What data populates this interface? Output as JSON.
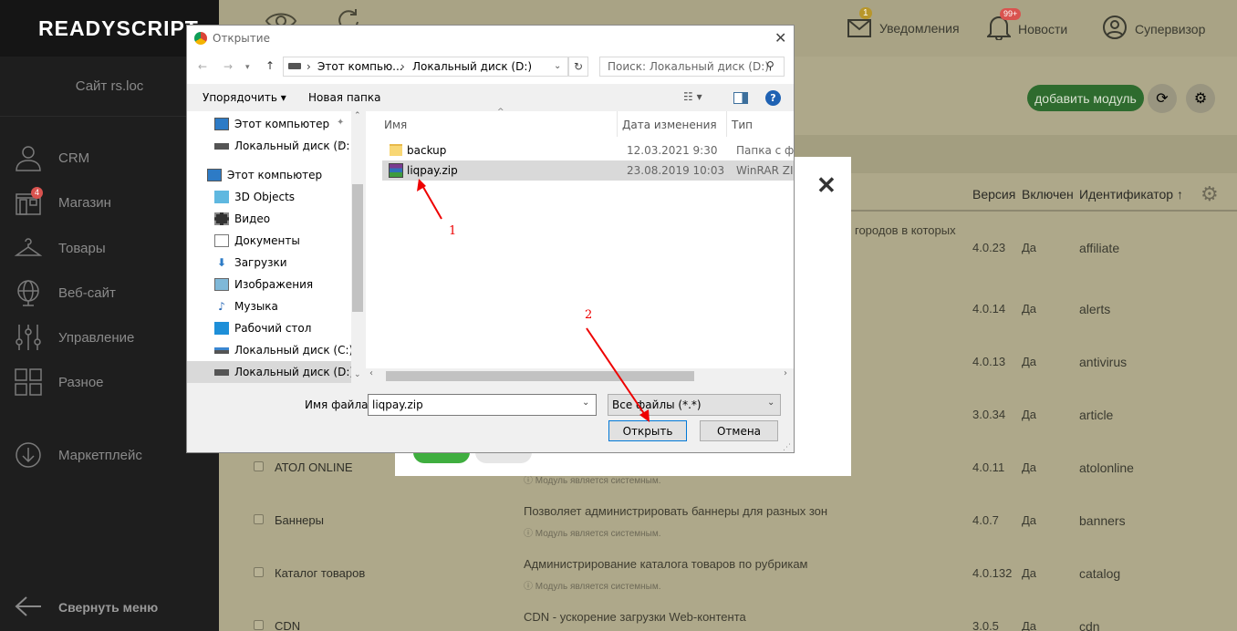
{
  "brand": "READYSCRIPT",
  "site_label": "Сайт rs.loc",
  "nav": [
    {
      "label": "CRM",
      "icon": "users-icon"
    },
    {
      "label": "Магазин",
      "icon": "store-icon",
      "badge": "4"
    },
    {
      "label": "Товары",
      "icon": "hanger-icon"
    },
    {
      "label": "Веб-сайт",
      "icon": "globe-icon"
    },
    {
      "label": "Управление",
      "icon": "sliders-icon"
    },
    {
      "label": "Разное",
      "icon": "grid-icon"
    },
    {
      "label": "Маркетплейс",
      "icon": "download-circle-icon"
    }
  ],
  "collapse_label": "Свернуть меню",
  "topbar": {
    "notifications": {
      "label": "Уведомления",
      "badge": "1"
    },
    "news": {
      "label": "Новости",
      "badge": "99+"
    },
    "user": {
      "label": "Супервизор"
    }
  },
  "add_module": "добавить модуль",
  "columns": {
    "version": "Версия",
    "enabled": "Включен",
    "identifier": "Идентификатор ↑"
  },
  "modules": [
    {
      "name": "",
      "desc": "городов в которых",
      "version": "4.0.23",
      "enabled": "Да",
      "id": "affiliate"
    },
    {
      "name": "",
      "desc": "",
      "version": "4.0.14",
      "enabled": "Да",
      "id": "alerts"
    },
    {
      "name": "",
      "desc": "",
      "version": "4.0.13",
      "enabled": "Да",
      "id": "antivirus"
    },
    {
      "name": "",
      "desc": "",
      "version": "3.0.34",
      "enabled": "Да",
      "id": "article"
    },
    {
      "name": "АТОЛ ONLINE",
      "desc": "",
      "note": "ⓘ Модуль является системным.",
      "version": "4.0.11",
      "enabled": "Да",
      "id": "atolonline"
    },
    {
      "name": "Баннеры",
      "desc": "Позволяет администрировать баннеры для разных зон",
      "note": "ⓘ Модуль является системным.",
      "version": "4.0.7",
      "enabled": "Да",
      "id": "banners"
    },
    {
      "name": "Каталог товаров",
      "desc": "Администрирование каталога товаров по рубрикам",
      "note": "ⓘ Модуль является системным.",
      "version": "4.0.132",
      "enabled": "Да",
      "id": "catalog"
    },
    {
      "name": "CDN",
      "desc": "CDN - ускорение загрузки Web-контента",
      "version": "3.0.5",
      "enabled": "Да",
      "id": "cdn"
    }
  ],
  "dialog": {
    "title": "Открытие",
    "path": [
      "Этот компью...",
      "Локальный диск (D:)"
    ],
    "search_placeholder": "Поиск: Локальный диск (D:)",
    "organize": "Упорядочить ▾",
    "new_folder": "Новая папка",
    "tree": [
      {
        "label": "Этот компьютер",
        "icon": "computer-icon",
        "pinned": true
      },
      {
        "label": "Локальный диск (D:",
        "icon": "drive-icon",
        "pinned": true
      },
      {
        "label": "Этот компьютер",
        "icon": "computer-icon"
      },
      {
        "label": "3D Objects",
        "icon": "cube-icon"
      },
      {
        "label": "Видео",
        "icon": "film-icon"
      },
      {
        "label": "Документы",
        "icon": "document-icon"
      },
      {
        "label": "Загрузки",
        "icon": "download-arrow-icon"
      },
      {
        "label": "Изображения",
        "icon": "picture-icon"
      },
      {
        "label": "Музыка",
        "icon": "music-note-icon"
      },
      {
        "label": "Рабочий стол",
        "icon": "desktop-icon"
      },
      {
        "label": "Локальный диск (C:)",
        "icon": "drive-c-icon"
      },
      {
        "label": "Локальный диск (D:)",
        "icon": "drive-icon"
      }
    ],
    "columns": {
      "name": "Имя",
      "date": "Дата изменения",
      "type": "Тип"
    },
    "files": [
      {
        "name": "backup",
        "date": "12.03.2021 9:30",
        "type": "Папка с файл",
        "icon": "folder-icon"
      },
      {
        "name": "liqpay.zip",
        "date": "23.08.2019 10:03",
        "type": "WinRAR ZIP a",
        "icon": "winrar-archive-icon"
      }
    ],
    "filename_label": "Имя файла:",
    "filename_value": "liqpay.zip",
    "filter": "Все файлы (*.*)",
    "open": "Открыть",
    "cancel": "Отмена"
  },
  "annotations": [
    "1",
    "2"
  ],
  "colors": {
    "accent": "#2e6b2e",
    "annotation": "#ee0000",
    "selection": "#d9d9d9"
  }
}
